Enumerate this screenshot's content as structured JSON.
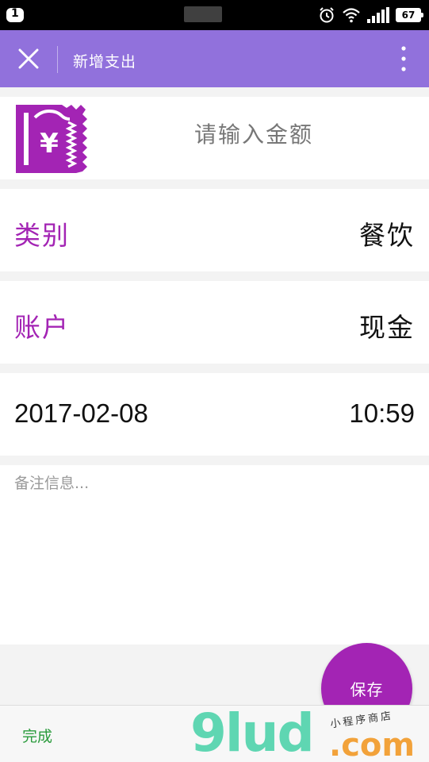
{
  "status_bar": {
    "notification_count": "1",
    "battery": "67"
  },
  "header": {
    "title": "新增支出"
  },
  "amount": {
    "placeholder": "请输入金额"
  },
  "category": {
    "label": "类别",
    "value": "餐饮"
  },
  "account": {
    "label": "账户",
    "value": "现金"
  },
  "datetime": {
    "date": "2017-02-08",
    "time": "10:59"
  },
  "note": {
    "placeholder": "备注信息..."
  },
  "save_button": "保存",
  "keyboard": {
    "done_label": "完成"
  },
  "watermark": {
    "logo": "9lud",
    "domain": ".com",
    "tagline": "小程序商店"
  },
  "colors": {
    "accent": "#a324b4",
    "header": "#9171dc",
    "done": "#2a9b3c"
  }
}
